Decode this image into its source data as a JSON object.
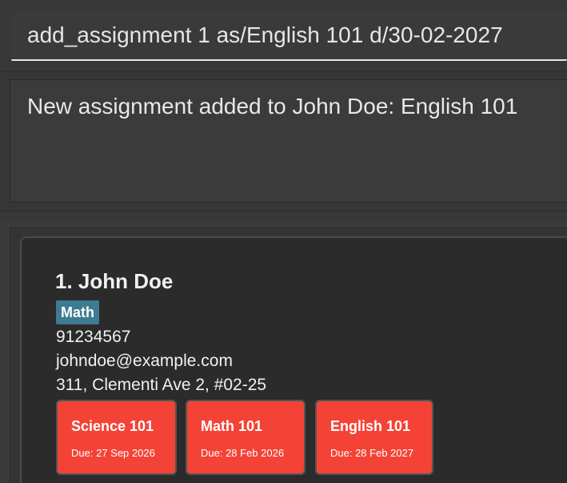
{
  "command": {
    "value": "add_assignment 1 as/English 101 d/30-02-2027"
  },
  "result": {
    "message": "New assignment added to John Doe: English 101"
  },
  "persons": [
    {
      "index_name": "1. John Doe",
      "tags": [
        "Math"
      ],
      "phone": "91234567",
      "email": "johndoe@example.com",
      "address": "311, Clementi Ave 2, #02-25",
      "assignments": [
        {
          "title": "Science 101",
          "due": "Due: 27 Sep 2026"
        },
        {
          "title": "Math 101",
          "due": "Due: 28 Feb 2026"
        },
        {
          "title": "English 101",
          "due": "Due: 28 Feb 2027"
        }
      ]
    }
  ],
  "colors": {
    "background": "#383838",
    "card": "#2b2b2b",
    "tag": "#3e7b91",
    "assignment": "#f44336",
    "text": "#f0f0f0"
  }
}
